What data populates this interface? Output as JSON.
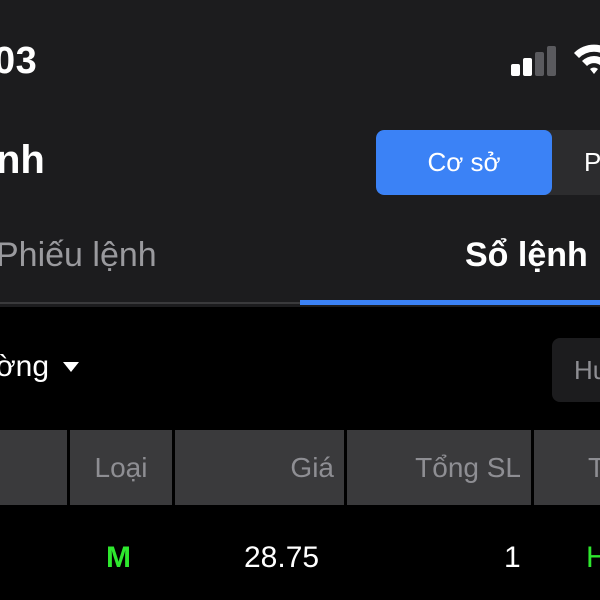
{
  "status_bar": {
    "time": "03",
    "icons": [
      "cellular-signal-icon",
      "wifi-icon"
    ]
  },
  "header": {
    "title": "nh",
    "segment": {
      "active_label": "Cơ sở",
      "other_label": "P"
    }
  },
  "tabs": [
    {
      "label": "Phiếu lệnh",
      "active": false
    },
    {
      "label": "Sổ lệnh",
      "active": true
    }
  ],
  "filter": {
    "dropdown_label": "ờng",
    "button_label": "Hu"
  },
  "table": {
    "columns": [
      "",
      "Loại",
      "Giá",
      "Tổng SL",
      "T"
    ],
    "rows": [
      {
        "type": "M",
        "price": "28.75",
        "quantity": "1",
        "status": "H"
      }
    ]
  },
  "colors": {
    "accent": "#3b82f6",
    "buy": "#2ee82e",
    "panel": "#1c1c1e",
    "header_cell": "#3a3a3c"
  }
}
